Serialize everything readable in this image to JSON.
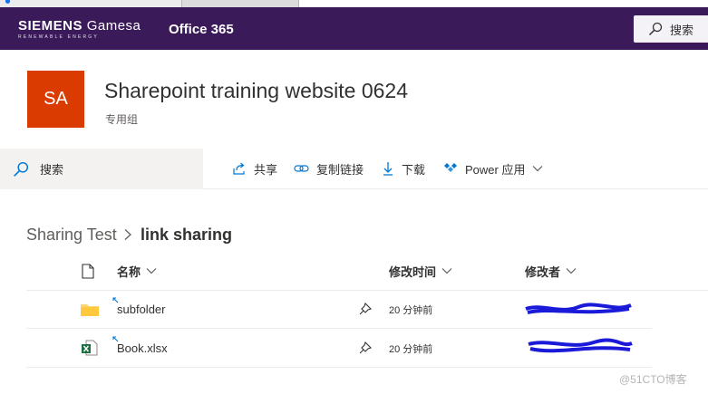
{
  "suite_bar": {
    "brand_main": "SIEMENS",
    "brand_secondary": "Gamesa",
    "brand_tagline": "RENEWABLE ENERGY",
    "app_name": "Office 365",
    "search_label": "搜索",
    "background_color": "#3b1a5a"
  },
  "site": {
    "logo_initials": "SA",
    "logo_color": "#da3b01",
    "title": "Sharepoint training website 0624",
    "subtitle": "专用组"
  },
  "left_search": {
    "label": "搜索"
  },
  "command_bar": {
    "share": "共享",
    "copy_link": "复制链接",
    "download": "下载",
    "power_apps": "Power 应用"
  },
  "breadcrumb": {
    "parent": "Sharing Test",
    "current": "link sharing"
  },
  "list": {
    "columns": {
      "name": "名称",
      "modified": "修改时间",
      "modified_by": "修改者"
    },
    "rows": [
      {
        "icon": "folder-icon",
        "name": "subfolder",
        "modified": "20 分钟前",
        "modified_by": ""
      },
      {
        "icon": "excel-icon",
        "name": "Book.xlsx",
        "modified": "20 分钟前",
        "modified_by": ""
      }
    ]
  },
  "watermark": "@51CTO博客"
}
